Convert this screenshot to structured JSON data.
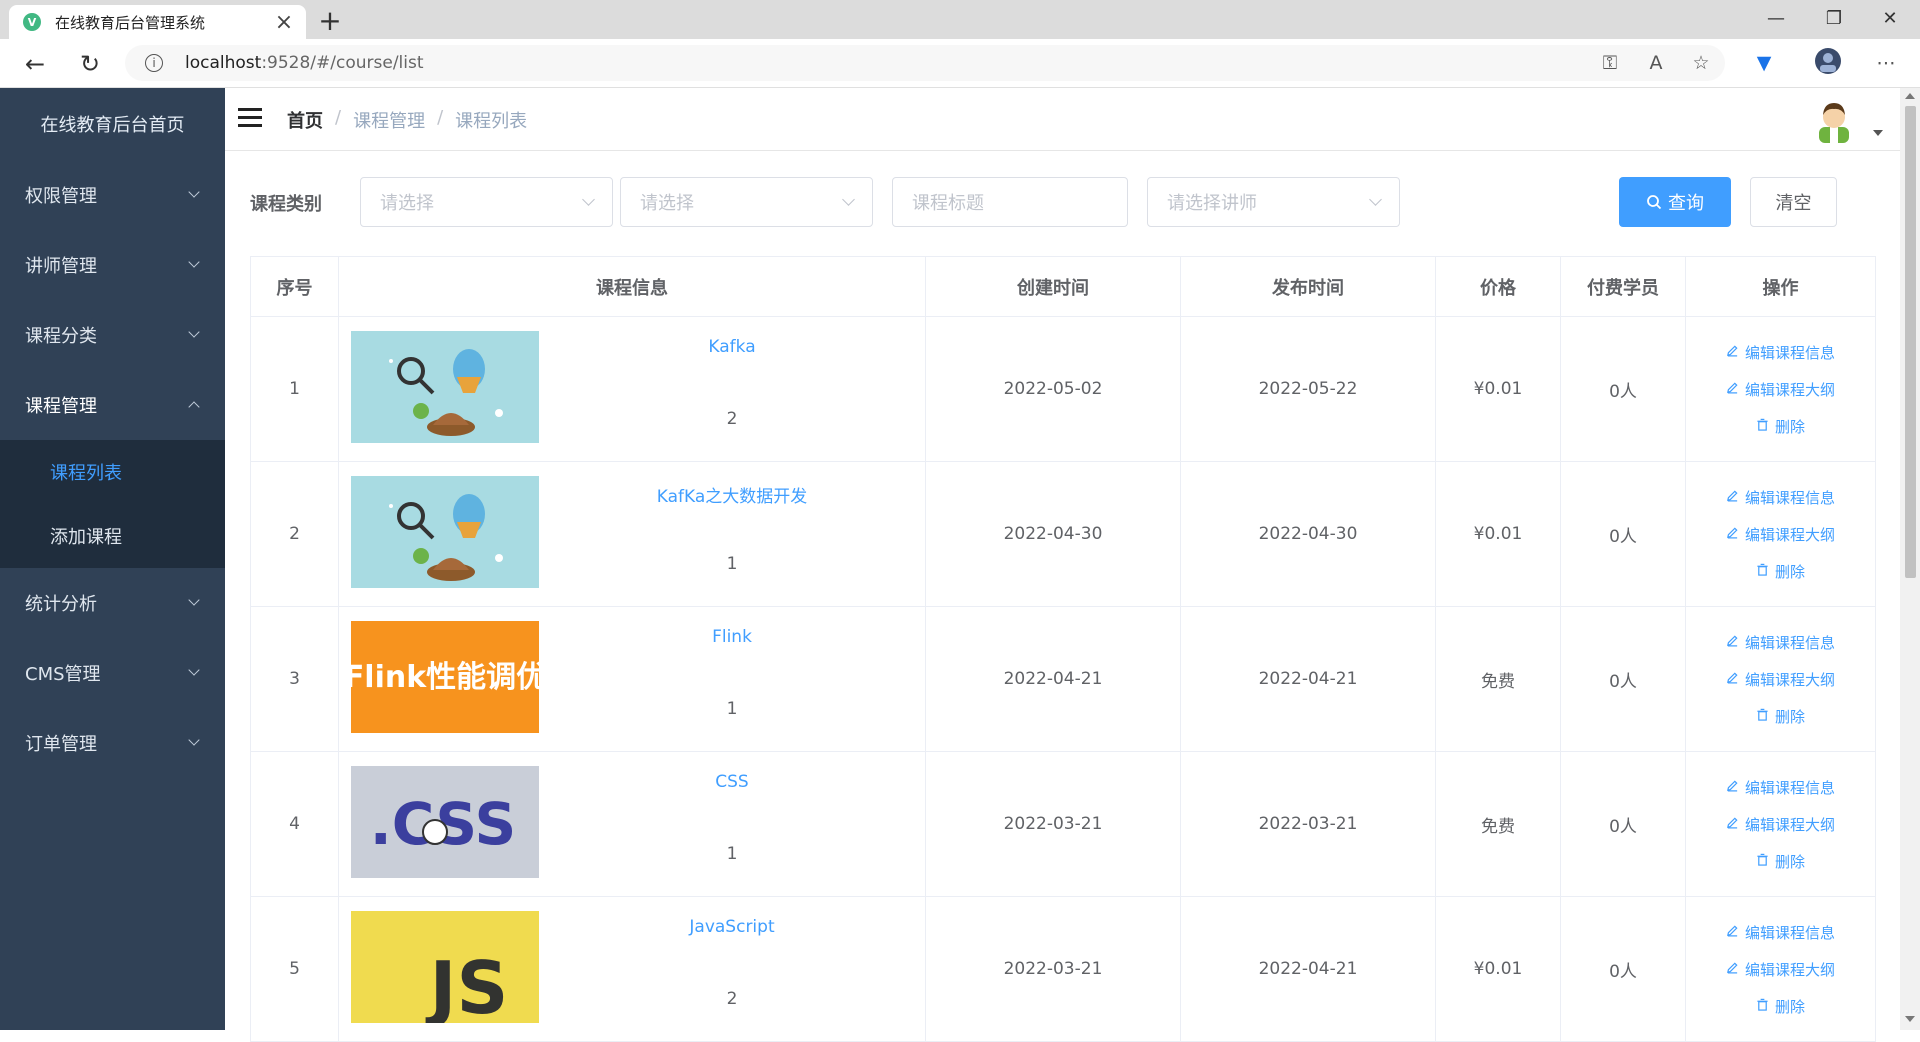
{
  "browser": {
    "tab_title": "在线教育后台管理系统",
    "favicon_letter": "V",
    "url_host": "localhost",
    "url_rest": ":9528/#/course/list"
  },
  "sidebar": {
    "title": "在线教育后台首页",
    "items": [
      {
        "label": "权限管理"
      },
      {
        "label": "讲师管理"
      },
      {
        "label": "课程分类"
      },
      {
        "label": "课程管理"
      },
      {
        "label": "统计分析"
      },
      {
        "label": "CMS管理"
      },
      {
        "label": "订单管理"
      }
    ],
    "course_submenu": [
      {
        "label": "课程列表"
      },
      {
        "label": "添加课程"
      }
    ]
  },
  "breadcrumb": {
    "home": "首页",
    "level1": "课程管理",
    "level2": "课程列表",
    "separator": "/"
  },
  "filters": {
    "label": "课程类别",
    "category1_placeholder": "请选择",
    "category2_placeholder": "请选择",
    "title_placeholder": "课程标题",
    "teacher_placeholder": "请选择讲师",
    "search_label": "查询",
    "clear_label": "清空"
  },
  "table": {
    "headers": {
      "index": "序号",
      "info": "课程信息",
      "created": "创建时间",
      "published": "发布时间",
      "price": "价格",
      "students": "付费学员",
      "actions": "操作"
    },
    "actions": {
      "edit_info": "编辑课程信息",
      "edit_outline": "编辑课程大纲",
      "delete": "删除"
    },
    "rows": [
      {
        "index": "1",
        "title": "Kafka",
        "count": "2",
        "created": "2022-05-02",
        "published": "2022-05-22",
        "price": "¥0.01",
        "students": "0人",
        "thumb": "balloon"
      },
      {
        "index": "2",
        "title": "KafKa之大数据开发",
        "count": "1",
        "created": "2022-04-30",
        "published": "2022-04-30",
        "price": "¥0.01",
        "students": "0人",
        "thumb": "balloon"
      },
      {
        "index": "3",
        "title": "Flink",
        "count": "1",
        "created": "2022-04-21",
        "published": "2022-04-21",
        "price": "免费",
        "students": "0人",
        "thumb": "flink",
        "thumb_text": "Flink性能调优"
      },
      {
        "index": "4",
        "title": "CSS",
        "count": "1",
        "created": "2022-03-21",
        "published": "2022-03-21",
        "price": "免费",
        "students": "0人",
        "thumb": "css",
        "thumb_text": ".CSS"
      },
      {
        "index": "5",
        "title": "JavaScript",
        "count": "2",
        "created": "2022-03-21",
        "published": "2022-04-21",
        "price": "¥0.01",
        "students": "0人",
        "thumb": "js",
        "thumb_text": "JS"
      }
    ]
  },
  "colors": {
    "sidebar_bg": "#304156",
    "submenu_bg": "#1f2d3d",
    "accent": "#409eff"
  }
}
